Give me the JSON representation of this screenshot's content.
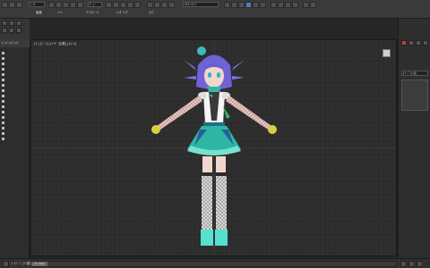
{
  "toolbar": {
    "undo_field": "ﾄｰﾙ",
    "selection_filter": "ﾋﾞｭｰ",
    "named_selection": "ﾙﾁｽｰｼﾋﾟﾄ",
    "menu_edit": "編集",
    "menu_toolbar": "ﾂｰﾙ",
    "menu_workspace": "ﾜｰｸｽﾍﾟｰｽ",
    "menu_render": "ﾚﾝﾀﾞﾘﾝｸﾞ",
    "menu_help": "ﾍﾙﾌﾟ"
  },
  "left_panel": {
    "header_label": "ﾎﾟﾘｺﾞﾝﾓﾃﾞﾘﾝｸﾞ",
    "scene_items": [
      "",
      "",
      "",
      "",
      "",
      "",
      "",
      "",
      "",
      "",
      "",
      "",
      "",
      "",
      "",
      "",
      ""
    ]
  },
  "viewport": {
    "label": "[+] [ﾊﾟｰｽ] [ﾕｰｻﾞｰ定義] [ｽﾑｰｽ]"
  },
  "right_panel": {
    "object_name": "ｵﾌﾞｼﾞｪｸﾄ名"
  },
  "status": {
    "frame": "0 / 100",
    "selection": "1 ｵﾌﾞｼﾞｪｸﾄ選択"
  },
  "colors": {
    "accent": "#4a7fc1",
    "background": "#262626",
    "viewport": "#2c2c2c"
  }
}
